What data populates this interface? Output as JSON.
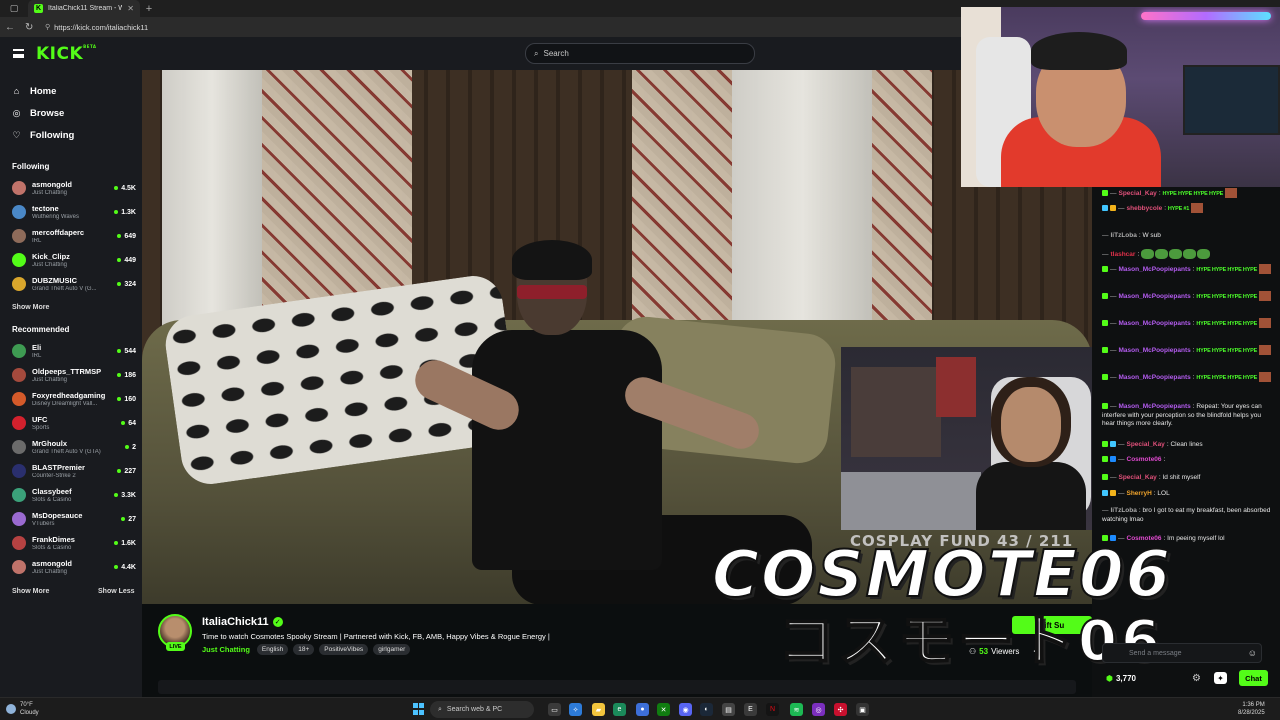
{
  "browser": {
    "tab_title": "ItaliaChick11 Stream - Watc",
    "url": "https://kick.com/italiachick11"
  },
  "header": {
    "logo": "KICK",
    "logo_sup": "BETA",
    "search_placeholder": "Search"
  },
  "sidebar": {
    "nav": [
      {
        "label": "Home",
        "icon": "home-icon"
      },
      {
        "label": "Browse",
        "icon": "compass-icon"
      },
      {
        "label": "Following",
        "icon": "heart-icon"
      }
    ],
    "following_title": "Following",
    "following": [
      {
        "name": "asmongold",
        "category": "Just Chatting",
        "viewers": "4.5K",
        "color": "#c0736a"
      },
      {
        "name": "tectone",
        "category": "Wuthering Waves",
        "viewers": "1.3K",
        "color": "#4a88c7"
      },
      {
        "name": "mercoffdaperc",
        "category": "IRL",
        "viewers": "649",
        "color": "#8e6b5a"
      },
      {
        "name": "Kick_Clipz",
        "category": "Just Chatting",
        "viewers": "449",
        "color": "#53fc18"
      },
      {
        "name": "DUBZMUSIC",
        "category": "Grand Theft Auto V (G...",
        "viewers": "324",
        "color": "#d9a62c"
      }
    ],
    "following_show_more": "Show More",
    "recommended_title": "Recommended",
    "recommended": [
      {
        "name": "Eli",
        "category": "IRL",
        "viewers": "544",
        "color": "#3e9b52"
      },
      {
        "name": "Oldpeeps_TTRMSP",
        "category": "Just Chatting",
        "viewers": "186",
        "color": "#a44a3d"
      },
      {
        "name": "Foxyredheadgaming",
        "category": "Disney Dreamlight Vall...",
        "viewers": "160",
        "color": "#d45a2a"
      },
      {
        "name": "UFC",
        "category": "Sports",
        "viewers": "64",
        "color": "#d3212d"
      },
      {
        "name": "MrGhoulx",
        "category": "Grand Theft Auto V (GTA)",
        "viewers": "2",
        "color": "#6b6b6b"
      },
      {
        "name": "BLASTPremier",
        "category": "Counter-Strike 2",
        "viewers": "227",
        "color": "#2a2f6e"
      },
      {
        "name": "Classybeef",
        "category": "Slots & Casino",
        "viewers": "3.3K",
        "color": "#3ba17a"
      },
      {
        "name": "MsDopesauce",
        "category": "VTubers",
        "viewers": "27",
        "color": "#9a6ad0"
      },
      {
        "name": "FrankDimes",
        "category": "Slots & Casino",
        "viewers": "1.6K",
        "color": "#b64242"
      },
      {
        "name": "asmongold",
        "category": "Just Chatting",
        "viewers": "4.4K",
        "color": "#c0736a"
      }
    ],
    "show_more": "Show More",
    "show_less": "Show Less"
  },
  "stream": {
    "channel": "ItaliaChick11",
    "live": "LIVE",
    "title": "Time to watch Cosmotes Spooky Stream | Partnered with Kick, FB, AMB, Happy Vibes & Rogue Energy |",
    "category": "Just Chatting",
    "tags": [
      "English",
      "18+",
      "PositiveVibes",
      "girlgamer"
    ],
    "viewers_count": "53",
    "viewers_label": "Viewers",
    "gift_label": "Gift Su"
  },
  "overlay": {
    "fund": "COSPLAY FUND  43 / 211",
    "name": "COSMOTE06",
    "jp": "コスモート06"
  },
  "chat": {
    "messages": [
      {
        "user": "Special_Kay",
        "color": "#e0507a",
        "badges": [
          "b-sub"
        ],
        "text": "",
        "hype": "HYPE HYPE HYPE HYPE"
      },
      {
        "user": "shebbycole",
        "color": "#e0507a",
        "badges": [
          "b-gift",
          "b-crown"
        ],
        "text": "",
        "hype": "HYPE #1"
      },
      {
        "user": "IiTzLoba",
        "color": "#aaaaaa",
        "badges": [],
        "text": "W sub",
        "hype": ""
      },
      {
        "user": "tlashcar",
        "color": "#e0304a",
        "badges": [],
        "text": "",
        "pepes": 5
      },
      {
        "user": "Mason_McPoopiepants",
        "color": "#b45cf0",
        "badges": [
          "b-sub"
        ],
        "text": "",
        "hype": "HYPE HYPE HYPE HYPE"
      },
      {
        "user": "Mason_McPoopiepants",
        "color": "#b45cf0",
        "badges": [
          "b-sub"
        ],
        "text": "",
        "hype": "HYPE HYPE HYPE HYPE"
      },
      {
        "user": "Mason_McPoopiepants",
        "color": "#b45cf0",
        "badges": [
          "b-sub"
        ],
        "text": "",
        "hype": "HYPE HYPE HYPE HYPE"
      },
      {
        "user": "Mason_McPoopiepants",
        "color": "#b45cf0",
        "badges": [
          "b-sub"
        ],
        "text": "",
        "hype": "HYPE HYPE HYPE HYPE"
      },
      {
        "user": "Mason_McPoopiepants",
        "color": "#b45cf0",
        "badges": [
          "b-sub"
        ],
        "text": "",
        "hype": "HYPE HYPE HYPE HYPE"
      },
      {
        "user": "Mason_McPoopiepants",
        "color": "#b45cf0",
        "badges": [
          "b-sub"
        ],
        "text": "Repeat: Your eyes can interfere with your perception so the blindfold helps you hear things more clearly.",
        "hype": ""
      },
      {
        "user": "Special_Kay",
        "color": "#e0507a",
        "badges": [
          "b-sub",
          "b-gift"
        ],
        "text": "Clean lines",
        "hype": ""
      },
      {
        "user": "Cosmote06",
        "color": "#e04ad0",
        "badges": [
          "b-sub",
          "b-ver"
        ],
        "text": "",
        "hype": ""
      },
      {
        "user": "Special_Kay",
        "color": "#e0507a",
        "badges": [
          "b-sub"
        ],
        "text": "Id shit myself",
        "hype": ""
      },
      {
        "user": "SherryH",
        "color": "#f2a52c",
        "badges": [
          "b-gift",
          "b-crown"
        ],
        "text": "LOL",
        "hype": ""
      },
      {
        "user": "IiTzLoba",
        "color": "#aaaaaa",
        "badges": [],
        "text": "bro I got to eat my breakfast, been absorbed watching lmao",
        "hype": ""
      },
      {
        "user": "Cosmote06",
        "color": "#e04ad0",
        "badges": [
          "b-sub",
          "b-ver"
        ],
        "text": "Im peeing myself lol",
        "hype": ""
      }
    ],
    "input_placeholder": "Send a message",
    "points": "3,770",
    "chat_button": "Chat"
  },
  "taskbar": {
    "temp": "70°F",
    "weather": "Cloudy",
    "search": "Search web & PC",
    "time": "1:36 PM",
    "date": "8/28/2025"
  }
}
